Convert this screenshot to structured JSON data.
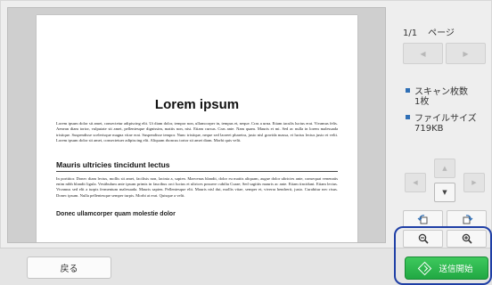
{
  "page_indicator": {
    "current": "1/1",
    "label": "ページ"
  },
  "page_nav": {
    "prev": "◀",
    "next": "▶"
  },
  "scan_count": {
    "label": "スキャン枚数",
    "value": "1枚"
  },
  "file_size": {
    "label": "ファイルサイズ",
    "value": "719KB"
  },
  "colors": {
    "accent": "#2f6fb5",
    "send_green": "#2bb64c",
    "highlight": "#1f3fa6"
  },
  "document": {
    "title": "Lorem ipsum",
    "para1": "Lorem ipsum dolor sit amet, consectetur adipiscing elit. Ut diam dolor, tempor non, ullamcorper in, tempus et, neque. Cras a urna. Etiam iaculis luctus erat. Vivamus felis. Aenean diam tortor, vulputate sit amet, pellentesque dignissim, mattis non, nisi. Etiam cursus. Cras ante. Nam quam. Mauris et mi. Sed ac nulla in lorem malesuada tristique. Suspendisse scelerisque magna vitae erat. Suspendisse tempor. Nunc tristique, neque sed laoreet pharetra, justo nisl gravida massa, et luctus lectus justo et velit. Lorem ipsum dolor sit amet, consectetuer adipiscing elit. Aliquam rhoncus tortor sit amet diam. Morbi quis velit.",
    "heading2": "Mauris ultricies tincidunt lectus",
    "para2": "In porttitor. Donec diam lectus, mollis sit amet, facilisis non, lacinia a, sapien. Maecenas blandit, dolor eu mattis aliquam, augue dolor ultricies ante, consequat venenatis enim nibh blandit ligula. Vestibulum ante ipsum primis in faucibus orci luctus et ultrices posuere cubilia Curae; Sed sagittis mauris ac ante. Etiam tincidunt. Etiam lectus. Vivamus sed elit a turpis fermentum malesuada. Mauris sapien. Pellentesque elit. Mauris nisl dui, mollis vitae, semper et, viverra hendrerit, justo. Curabitur nec risus. Donec ipsum. Nulla pellentesque semper turpis. Morbi at erat. Quisque a velit.",
    "heading3": "Donec ullamcorper quam molestie dolor"
  },
  "dpad": {
    "up": "▲",
    "down": "▼",
    "left": "◀",
    "right": "▶"
  },
  "tools": {
    "rotate_left": "rotate-left-icon",
    "rotate_right": "rotate-right-icon",
    "zoom_out": "zoom-out-icon",
    "zoom_in": "zoom-in-icon"
  },
  "back_button": "戻る",
  "send_button": "送信開始"
}
